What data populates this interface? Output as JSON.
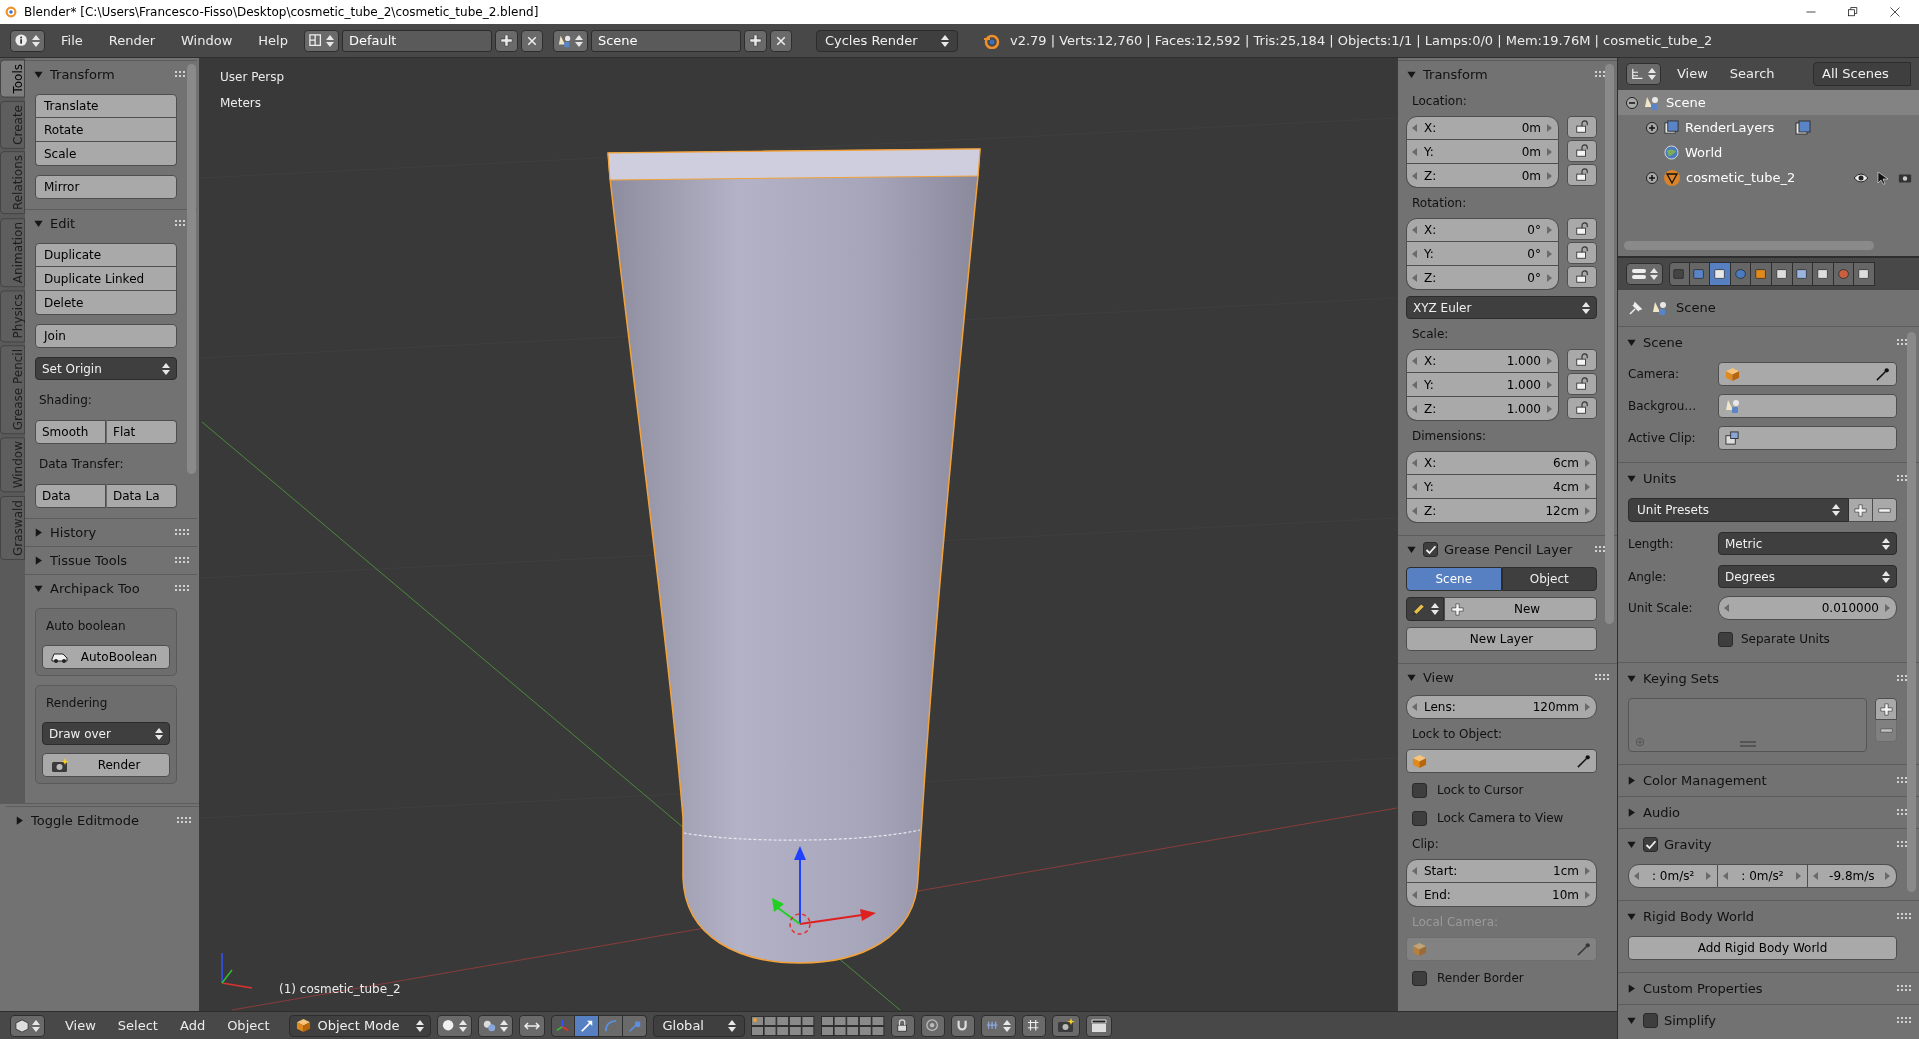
{
  "window": {
    "title": "Blender* [C:\\Users\\Francesco-Fisso\\Desktop\\cosmetic_tube_2\\cosmetic_tube_2.blend]"
  },
  "info_header": {
    "menus": [
      "File",
      "Render",
      "Window",
      "Help"
    ],
    "screen_layout": "Default",
    "scene": "Scene",
    "render_engine": "Cycles Render",
    "stats": "v2.79 | Verts:12,760 | Faces:12,592 | Tris:25,184 | Objects:1/1 | Lamps:0/0 | Mem:19.76M | cosmetic_tube_2"
  },
  "tool_tabs": [
    {
      "label": "Tools",
      "selected": true
    },
    {
      "label": "Create",
      "selected": false
    },
    {
      "label": "Relations",
      "selected": false
    },
    {
      "label": "Animation",
      "selected": false
    },
    {
      "label": "Physics",
      "selected": false
    },
    {
      "label": "Grease Pencil",
      "selected": false
    },
    {
      "label": "Window",
      "selected": false
    },
    {
      "label": "Graswald",
      "selected": false
    }
  ],
  "tool_shelf": {
    "panels": [
      {
        "title": "Transform",
        "expanded": true,
        "items": [
          {
            "kind": "stack",
            "buttons": [
              "Translate",
              "Rotate",
              "Scale"
            ]
          },
          {
            "kind": "button",
            "label": "Mirror"
          }
        ]
      },
      {
        "title": "Edit",
        "expanded": true,
        "items": [
          {
            "kind": "stack",
            "buttons": [
              "Duplicate",
              "Duplicate Linked",
              "Delete"
            ]
          },
          {
            "kind": "button",
            "label": "Join"
          },
          {
            "kind": "menu",
            "label": "Set Origin"
          },
          {
            "kind": "label",
            "text": "Shading:"
          },
          {
            "kind": "row",
            "buttons": [
              "Smooth",
              "Flat"
            ]
          },
          {
            "kind": "label",
            "text": "Data Transfer:"
          },
          {
            "kind": "row",
            "buttons": [
              "Data",
              "Data La"
            ]
          }
        ]
      },
      {
        "title": "History",
        "expanded": false
      },
      {
        "title": "Tissue Tools",
        "expanded": false
      },
      {
        "title": "Archipack Too",
        "expanded": true,
        "items": [
          {
            "kind": "box",
            "items": [
              {
                "kind": "label",
                "text": "Auto boolean"
              },
              {
                "kind": "button",
                "label": "AutoBoolean"
              }
            ]
          },
          {
            "kind": "box",
            "items": [
              {
                "kind": "label",
                "text": "Rendering"
              },
              {
                "kind": "menu",
                "label": "Draw over"
              },
              {
                "kind": "button",
                "label": "Render"
              }
            ]
          }
        ]
      }
    ],
    "toggle_editmode": {
      "title": "Toggle Editmode",
      "expanded": false
    }
  },
  "viewport": {
    "view_name": "User Persp",
    "units": "Meters",
    "object_label": "(1) cosmetic_tube_2"
  },
  "viewport_header": {
    "menus": [
      "View",
      "Select",
      "Add",
      "Object"
    ],
    "mode": "Object Mode",
    "orientation": "Global",
    "transform_manipulators": [
      {
        "selected": true
      },
      {
        "selected": false
      },
      {
        "selected": false
      }
    ]
  },
  "properties_region": {
    "panels": [
      {
        "title": "Transform",
        "expanded": true,
        "items": [
          {
            "kind": "label",
            "text": "Location:"
          },
          {
            "kind": "vector",
            "fields": [
              {
                "label": "X:",
                "value": "0m",
                "locked": false
              },
              {
                "label": "Y:",
                "value": "0m",
                "locked": false
              },
              {
                "label": "Z:",
                "value": "0m",
                "locked": false
              }
            ]
          },
          {
            "kind": "label",
            "text": "Rotation:"
          },
          {
            "kind": "vector",
            "fields": [
              {
                "label": "X:",
                "value": "0°",
                "locked": false
              },
              {
                "label": "Y:",
                "value": "0°",
                "locked": false
              },
              {
                "label": "Z:",
                "value": "0°",
                "locked": false
              }
            ]
          },
          {
            "kind": "menu",
            "label": "XYZ Euler"
          },
          {
            "kind": "label",
            "text": "Scale:"
          },
          {
            "kind": "vector",
            "fields": [
              {
                "label": "X:",
                "value": "1.000",
                "locked": false
              },
              {
                "label": "Y:",
                "value": "1.000",
                "locked": false
              },
              {
                "label": "Z:",
                "value": "1.000",
                "locked": false
              }
            ]
          },
          {
            "kind": "label",
            "text": "Dimensions:"
          },
          {
            "kind": "vector",
            "fields": [
              {
                "label": "X:",
                "value": "6cm"
              },
              {
                "label": "Y:",
                "value": "4cm"
              },
              {
                "label": "Z:",
                "value": "12cm"
              }
            ]
          }
        ]
      },
      {
        "title": "Grease Pencil Layer",
        "expanded": true,
        "checked": true,
        "items": [
          {
            "kind": "tabs",
            "tabs": [
              {
                "label": "Scene",
                "selected": true
              },
              {
                "label": "Object",
                "selected": false
              }
            ]
          },
          {
            "kind": "new_row",
            "label": "New"
          },
          {
            "kind": "button",
            "label": "New Layer"
          }
        ]
      },
      {
        "title": "View",
        "expanded": true,
        "items": [
          {
            "kind": "field",
            "label": "Lens:",
            "value": "120mm"
          },
          {
            "kind": "label",
            "text": "Lock to Object:",
            "disabled": false
          },
          {
            "kind": "object_field",
            "disabled": false
          },
          {
            "kind": "checkbox",
            "label": "Lock to Cursor",
            "checked": false
          },
          {
            "kind": "checkbox",
            "label": "Lock Camera to View",
            "checked": false
          },
          {
            "kind": "label",
            "text": "Clip:",
            "disabled": false
          },
          {
            "kind": "vector",
            "fields": [
              {
                "label": "Start:",
                "value": "1cm"
              },
              {
                "label": "End:",
                "value": "10m"
              }
            ]
          },
          {
            "kind": "label",
            "text": "Local Camera:",
            "disabled": true
          },
          {
            "kind": "object_field",
            "disabled": true
          },
          {
            "kind": "checkbox",
            "label": "Render Border",
            "checked": false
          }
        ]
      }
    ]
  },
  "outliner": {
    "menus": [
      "View",
      "Search"
    ],
    "display_mode": "All Scenes",
    "tree": [
      {
        "label": "Scene",
        "selected": true,
        "expanded": true,
        "children": [
          {
            "label": "RenderLayers",
            "selected": false,
            "expanded": false
          },
          {
            "label": "World",
            "selected": false
          },
          {
            "label": "cosmetic_tube_2",
            "selected": false,
            "expanded": false
          }
        ]
      }
    ]
  },
  "properties_editor": {
    "tabs": [
      {
        "selected": false
      },
      {
        "selected": false
      },
      {
        "selected": true
      },
      {
        "selected": false
      },
      {
        "selected": false
      },
      {
        "selected": false
      },
      {
        "selected": false
      },
      {
        "selected": false
      },
      {
        "selected": false
      },
      {
        "selected": false
      }
    ],
    "context": "Scene",
    "panels": [
      {
        "title": "Scene",
        "expanded": true,
        "items": [
          {
            "kind": "id_field",
            "label": "Camera:"
          },
          {
            "kind": "id_field",
            "label": "Backgrou…"
          },
          {
            "kind": "id_field",
            "label": "Active Clip:"
          }
        ]
      },
      {
        "title": "Units",
        "expanded": true,
        "items": [
          {
            "kind": "preset",
            "label": "Unit Presets"
          },
          {
            "kind": "menu_field",
            "label": "Length:",
            "value": "Metric"
          },
          {
            "kind": "menu_field",
            "label": "Angle:",
            "value": "Degrees"
          },
          {
            "kind": "number_field",
            "label": "Unit Scale:",
            "value": "0.010000"
          },
          {
            "kind": "checkbox",
            "label": "Separate Units",
            "checked": false
          }
        ]
      },
      {
        "title": "Keying Sets",
        "expanded": true,
        "items": [
          {
            "kind": "list"
          }
        ]
      },
      {
        "title": "Color Management",
        "expanded": false
      },
      {
        "title": "Audio",
        "expanded": false
      },
      {
        "title": "Gravity",
        "expanded": true,
        "checked": true,
        "items": [
          {
            "kind": "vector_row",
            "values": [
              ": 0m/s²",
              ": 0m/s²",
              "-9.8m/s"
            ]
          }
        ]
      },
      {
        "title": "Rigid Body World",
        "expanded": true,
        "items": [
          {
            "kind": "button",
            "label": "Add Rigid Body World"
          }
        ]
      },
      {
        "title": "Custom Properties",
        "expanded": false
      },
      {
        "title": "Simplify",
        "expanded": true,
        "checked": false
      }
    ]
  }
}
